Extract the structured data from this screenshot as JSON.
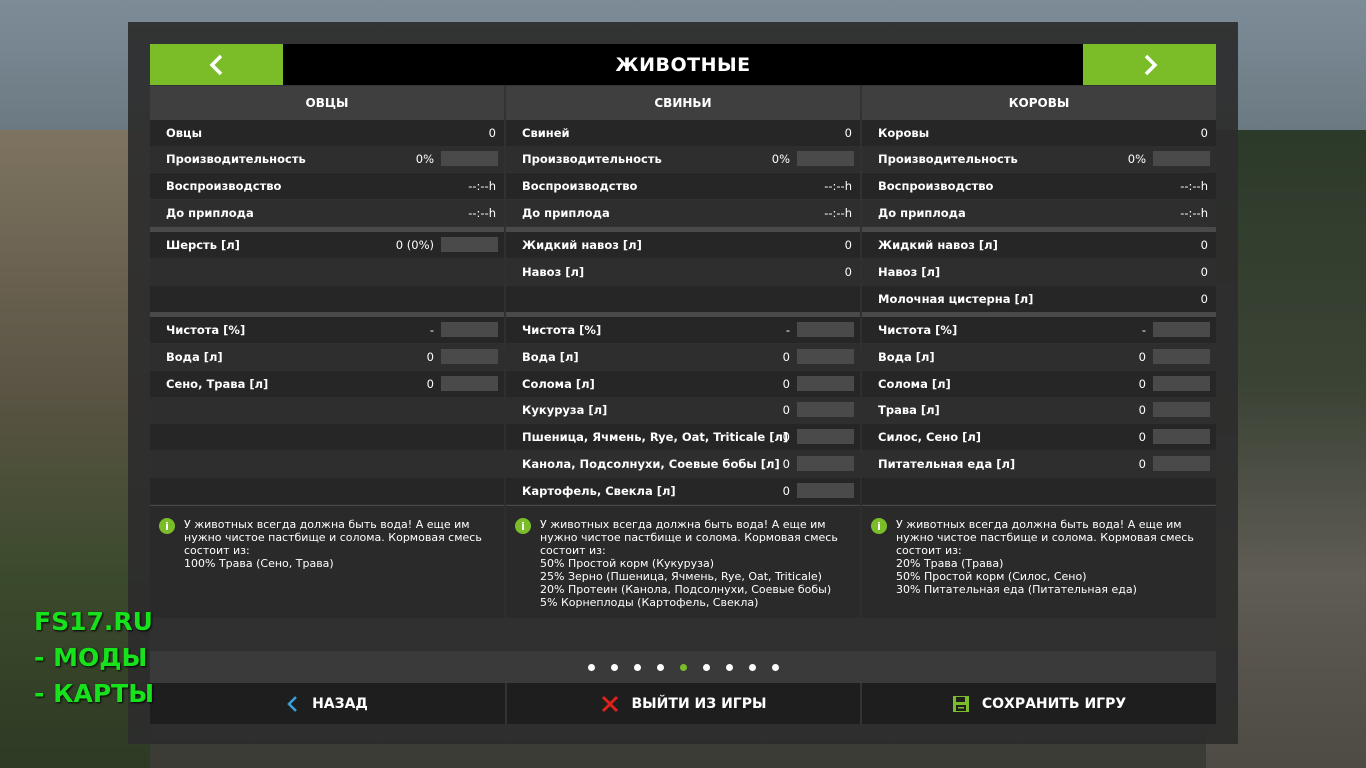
{
  "header": {
    "title": "ЖИВОТНЫЕ"
  },
  "columns": [
    {
      "name": "ОВЦЫ",
      "stats": [
        {
          "label": "Овцы",
          "value": "0",
          "bar": false
        },
        {
          "label": "Производительность",
          "value": "0%",
          "bar": true
        },
        {
          "label": "Воспроизводство",
          "value": "--:--h",
          "bar": false
        },
        {
          "label": "До приплода",
          "value": "--:--h",
          "bar": false
        }
      ],
      "products": [
        {
          "label": "Шерсть [л]",
          "value": "0 (0%)",
          "bar": true
        }
      ],
      "needs": [
        {
          "label": "Чистота [%]",
          "value": "-",
          "bar": true
        },
        {
          "label": "Вода [л]",
          "value": "0",
          "bar": true
        },
        {
          "label": "Сено, Трава [л]",
          "value": "0",
          "bar": true
        }
      ],
      "info": "У животных всегда должна быть вода! А еще им нужно чистое пастбище и солома. Кормовая смесь состоит из:\n100% Трава (Сено, Трава)"
    },
    {
      "name": "СВИНЬИ",
      "stats": [
        {
          "label": "Свиней",
          "value": "0",
          "bar": false
        },
        {
          "label": "Производительность",
          "value": "0%",
          "bar": true
        },
        {
          "label": "Воспроизводство",
          "value": "--:--h",
          "bar": false
        },
        {
          "label": "До приплода",
          "value": "--:--h",
          "bar": false
        }
      ],
      "products": [
        {
          "label": "Жидкий навоз [л]",
          "value": "0",
          "bar": false
        },
        {
          "label": "Навоз [л]",
          "value": "0",
          "bar": false
        }
      ],
      "needs": [
        {
          "label": "Чистота [%]",
          "value": "-",
          "bar": true
        },
        {
          "label": "Вода [л]",
          "value": "0",
          "bar": true
        },
        {
          "label": "Солома [л]",
          "value": "0",
          "bar": true
        },
        {
          "label": "Кукуруза [л]",
          "value": "0",
          "bar": true
        },
        {
          "label": "Пшеница, Ячмень, Rye, Oat, Triticale [л]",
          "value": "0",
          "bar": true
        },
        {
          "label": "Канола, Подсолнухи, Соевые бобы [л]",
          "value": "0",
          "bar": true
        },
        {
          "label": "Картофель, Свекла [л]",
          "value": "0",
          "bar": true
        }
      ],
      "info": "У животных всегда должна быть вода! А еще им нужно чистое пастбище и солома. Кормовая смесь состоит из:\n50% Простой корм (Кукуруза)\n25% Зерно (Пшеница, Ячмень, Rye, Oat, Triticale)\n20% Протеин (Канола, Подсолнухи, Соевые бобы)\n5% Корнеплоды (Картофель, Свекла)"
    },
    {
      "name": "КОРОВЫ",
      "stats": [
        {
          "label": "Коровы",
          "value": "0",
          "bar": false
        },
        {
          "label": "Производительность",
          "value": "0%",
          "bar": true
        },
        {
          "label": "Воспроизводство",
          "value": "--:--h",
          "bar": false
        },
        {
          "label": "До приплода",
          "value": "--:--h",
          "bar": false
        }
      ],
      "products": [
        {
          "label": "Жидкий навоз [л]",
          "value": "0",
          "bar": false
        },
        {
          "label": "Навоз [л]",
          "value": "0",
          "bar": false
        },
        {
          "label": "Молочная цистерна [л]",
          "value": "0",
          "bar": false
        }
      ],
      "needs": [
        {
          "label": "Чистота [%]",
          "value": "-",
          "bar": true
        },
        {
          "label": "Вода [л]",
          "value": "0",
          "bar": true
        },
        {
          "label": "Солома [л]",
          "value": "0",
          "bar": true
        },
        {
          "label": "Трава [л]",
          "value": "0",
          "bar": true
        },
        {
          "label": "Силос, Сено [л]",
          "value": "0",
          "bar": true
        },
        {
          "label": "Питательная еда [л]",
          "value": "0",
          "bar": true
        }
      ],
      "info": "У животных всегда должна быть вода! А еще им нужно чистое пастбище и солома. Кормовая смесь состоит из:\n20% Трава (Трава)\n50% Простой корм (Силос, Сено)\n30% Питательная еда (Питательная еда)"
    }
  ],
  "pagination": {
    "count": 9,
    "active_index": 4
  },
  "footer": {
    "back_label": "НАЗАД",
    "quit_label": "ВЫЙТИ ИЗ ИГРЫ",
    "save_label": "СОХРАНИТЬ ИГРУ"
  },
  "watermark": {
    "line1": "FS17.RU",
    "line2": "- МОДЫ",
    "line3": "- КАРТЫ"
  },
  "colors": {
    "accent": "#7bbd29",
    "quit_icon": "#e0201b",
    "back_icon": "#3aa0d8",
    "watermark": "#16e31b"
  }
}
